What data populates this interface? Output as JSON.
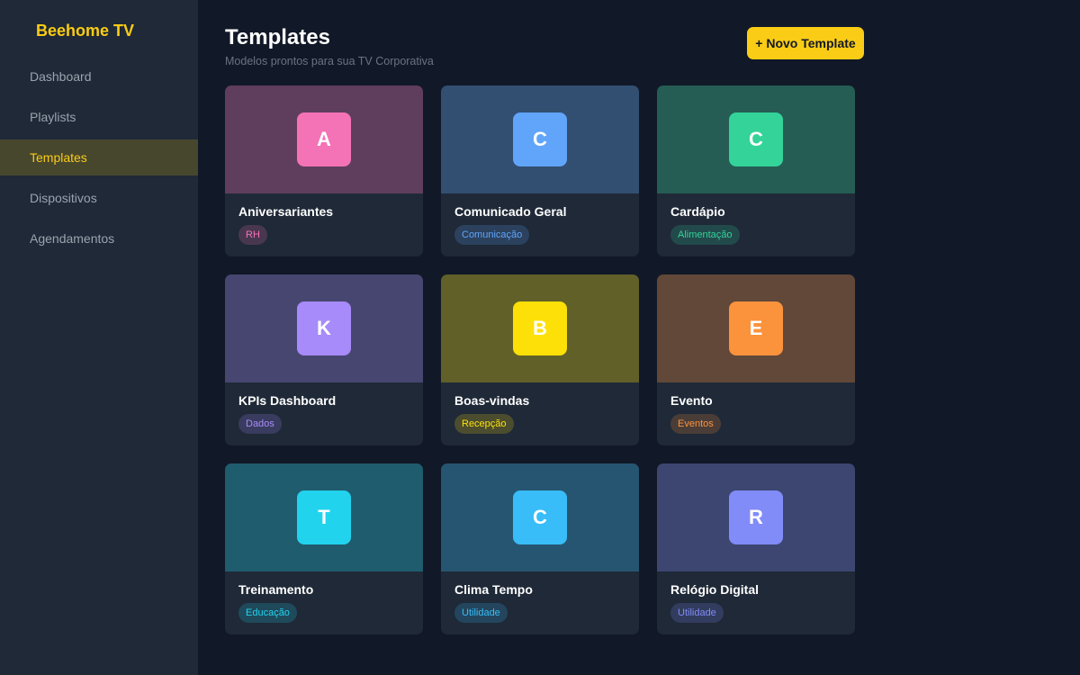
{
  "sidebar": {
    "brand": "Beehome TV",
    "items": [
      {
        "label": "Dashboard",
        "active": false
      },
      {
        "label": "Playlists",
        "active": false
      },
      {
        "label": "Templates",
        "active": true
      },
      {
        "label": "Dispositivos",
        "active": false
      },
      {
        "label": "Agendamentos",
        "active": false
      }
    ]
  },
  "header": {
    "title": "Templates",
    "subtitle": "Modelos prontos para sua TV Corporativa",
    "new_button": "+ Novo Template"
  },
  "templates": [
    {
      "letter": "A",
      "name": "Aniversariantes",
      "tag": "RH",
      "color": "#f472b6"
    },
    {
      "letter": "C",
      "name": "Comunicado Geral",
      "tag": "Comunicação",
      "color": "#60a5fa"
    },
    {
      "letter": "C",
      "name": "Cardápio",
      "tag": "Alimentação",
      "color": "#34d399"
    },
    {
      "letter": "K",
      "name": "KPIs Dashboard",
      "tag": "Dados",
      "color": "#a78bfa"
    },
    {
      "letter": "B",
      "name": "Boas-vindas",
      "tag": "Recepção",
      "color": "#fde008"
    },
    {
      "letter": "E",
      "name": "Evento",
      "tag": "Eventos",
      "color": "#fb923c"
    },
    {
      "letter": "T",
      "name": "Treinamento",
      "tag": "Educação",
      "color": "#22d3ee"
    },
    {
      "letter": "C",
      "name": "Clima Tempo",
      "tag": "Utilidade",
      "color": "#38bdf8"
    },
    {
      "letter": "R",
      "name": "Relógio Digital",
      "tag": "Utilidade",
      "color": "#818cf8"
    }
  ]
}
